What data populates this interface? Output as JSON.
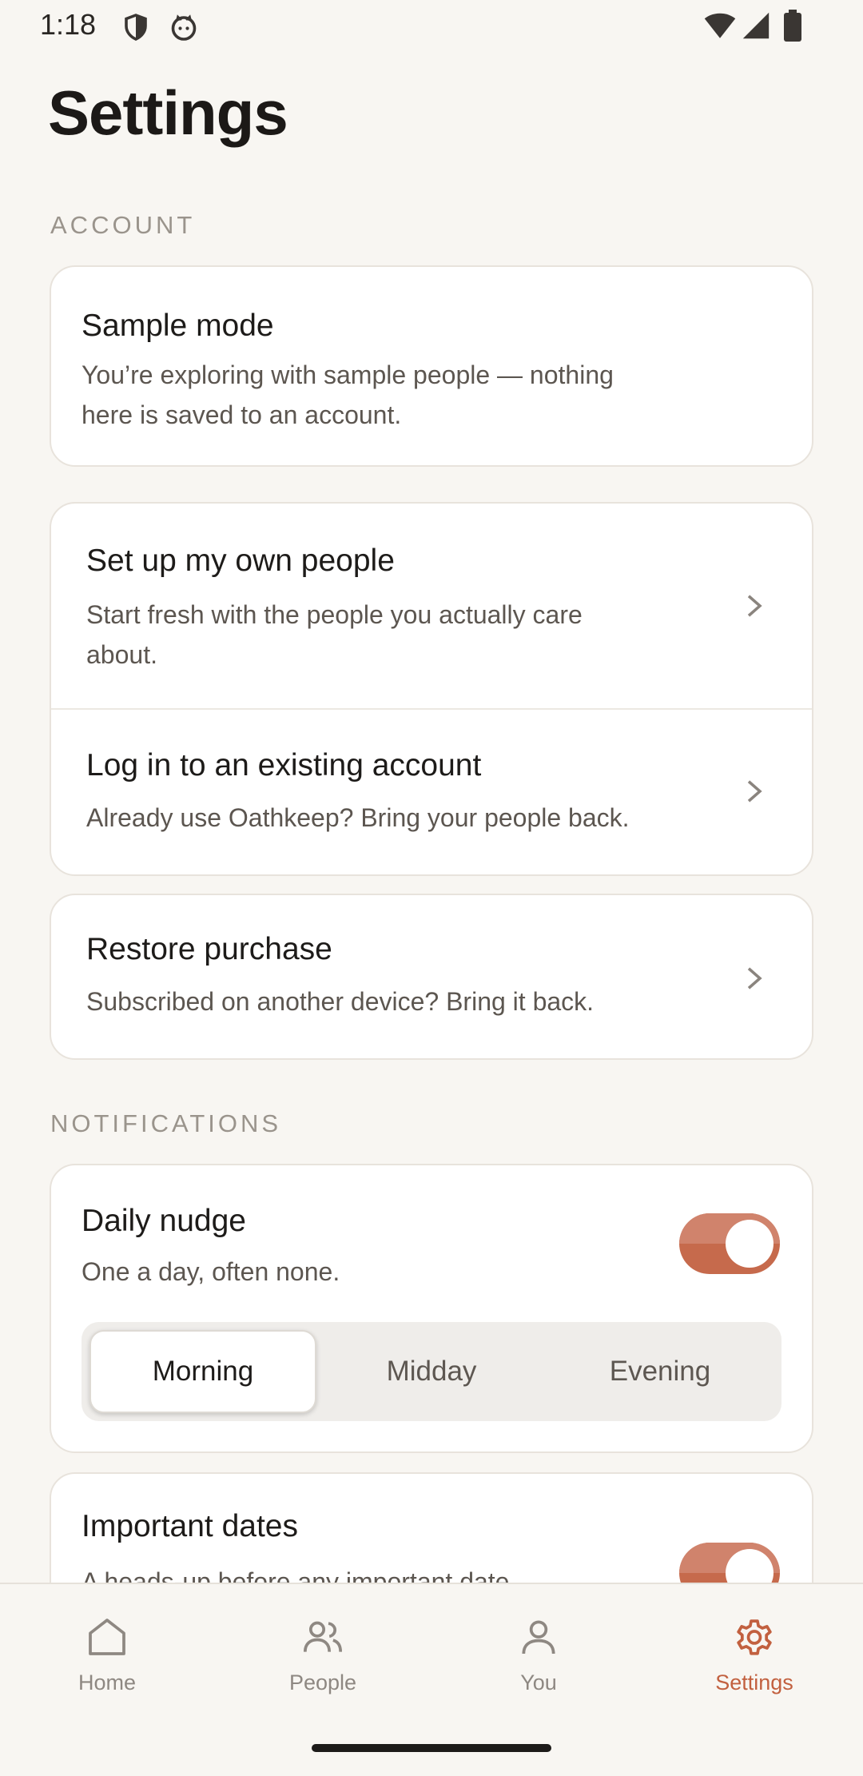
{
  "status_bar": {
    "time": "1:18"
  },
  "page": {
    "title": "Settings"
  },
  "sections": {
    "account": "ACCOUNT",
    "notifications": "NOTIFICATIONS"
  },
  "account": {
    "sample_mode": {
      "title": "Sample mode",
      "desc_line1": "You’re exploring with sample people — nothing",
      "desc_line2": "here is saved to an account."
    },
    "setup": {
      "title": "Set up my own people",
      "desc_line1": "Start fresh with the people you actually care",
      "desc_line2": "about."
    },
    "login": {
      "title": "Log in to an existing account",
      "desc": "Already use Oathkeep? Bring your people back."
    },
    "restore": {
      "title": "Restore purchase",
      "desc": "Subscribed on another device? Bring it back."
    }
  },
  "notifications": {
    "daily_nudge": {
      "title": "Daily nudge",
      "desc": "One a day, often none.",
      "enabled": true,
      "options": [
        "Morning",
        "Midday",
        "Evening"
      ],
      "selected": "Morning"
    },
    "important_dates": {
      "title": "Important dates",
      "desc": "A heads-up before any important date.",
      "enabled": true
    }
  },
  "bottom_nav": {
    "items": [
      {
        "label": "Home",
        "icon": "home-icon"
      },
      {
        "label": "People",
        "icon": "people-icon"
      },
      {
        "label": "You",
        "icon": "person-icon"
      },
      {
        "label": "Settings",
        "icon": "gear-icon"
      }
    ],
    "active": "Settings"
  },
  "colors": {
    "accent": "#c2603f",
    "toggle_on": "#c66a4c",
    "background": "#f8f6f2"
  }
}
